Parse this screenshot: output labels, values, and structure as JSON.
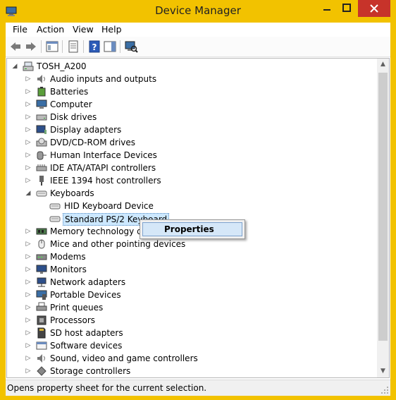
{
  "window": {
    "title": "Device Manager"
  },
  "menu": [
    {
      "label": "File"
    },
    {
      "label": "Action"
    },
    {
      "label": "View"
    },
    {
      "label": "Help"
    }
  ],
  "tree": {
    "root": "TOSH_A200",
    "items": [
      {
        "label": "Audio inputs and outputs",
        "icon": "speaker-icon",
        "state": "collapsed"
      },
      {
        "label": "Batteries",
        "icon": "battery-icon",
        "state": "collapsed"
      },
      {
        "label": "Computer",
        "icon": "computer-icon",
        "state": "collapsed"
      },
      {
        "label": "Disk drives",
        "icon": "disk-drive-icon",
        "state": "collapsed"
      },
      {
        "label": "Display adapters",
        "icon": "display-adapter-icon",
        "state": "collapsed"
      },
      {
        "label": "DVD/CD-ROM drives",
        "icon": "dvd-drive-icon",
        "state": "collapsed"
      },
      {
        "label": "Human Interface Devices",
        "icon": "hid-icon",
        "state": "collapsed"
      },
      {
        "label": "IDE ATA/ATAPI controllers",
        "icon": "ide-controller-icon",
        "state": "collapsed"
      },
      {
        "label": "IEEE 1394 host controllers",
        "icon": "firewire-icon",
        "state": "collapsed"
      },
      {
        "label": "Keyboards",
        "icon": "keyboard-icon",
        "state": "expanded"
      },
      {
        "label": "HID Keyboard Device",
        "icon": "keyboard-icon",
        "state": "child"
      },
      {
        "label": "Standard PS/2 Keyboard",
        "icon": "keyboard-icon",
        "state": "child-selected"
      },
      {
        "label": "Memory technology de",
        "icon": "memory-icon",
        "state": "collapsed"
      },
      {
        "label": "Mice and other pointing devices",
        "icon": "mouse-icon",
        "state": "collapsed"
      },
      {
        "label": "Modems",
        "icon": "modem-icon",
        "state": "collapsed"
      },
      {
        "label": "Monitors",
        "icon": "monitor-icon",
        "state": "collapsed"
      },
      {
        "label": "Network adapters",
        "icon": "network-icon",
        "state": "collapsed"
      },
      {
        "label": "Portable Devices",
        "icon": "portable-device-icon",
        "state": "collapsed"
      },
      {
        "label": "Print queues",
        "icon": "printer-icon",
        "state": "collapsed"
      },
      {
        "label": "Processors",
        "icon": "processor-icon",
        "state": "collapsed"
      },
      {
        "label": "SD host adapters",
        "icon": "sd-card-icon",
        "state": "collapsed"
      },
      {
        "label": "Software devices",
        "icon": "software-device-icon",
        "state": "collapsed"
      },
      {
        "label": "Sound, video and game controllers",
        "icon": "sound-icon",
        "state": "collapsed"
      },
      {
        "label": "Storage controllers",
        "icon": "storage-controller-icon",
        "state": "collapsed"
      }
    ]
  },
  "context_menu": {
    "items": [
      {
        "label": "Properties"
      }
    ]
  },
  "status": {
    "text": "Opens property sheet for the current selection."
  },
  "colors": {
    "titlebar": "#f2c200",
    "close_button": "#c7332a",
    "selection": "#cce8ff",
    "menu_highlight": "#d5e7f8"
  }
}
